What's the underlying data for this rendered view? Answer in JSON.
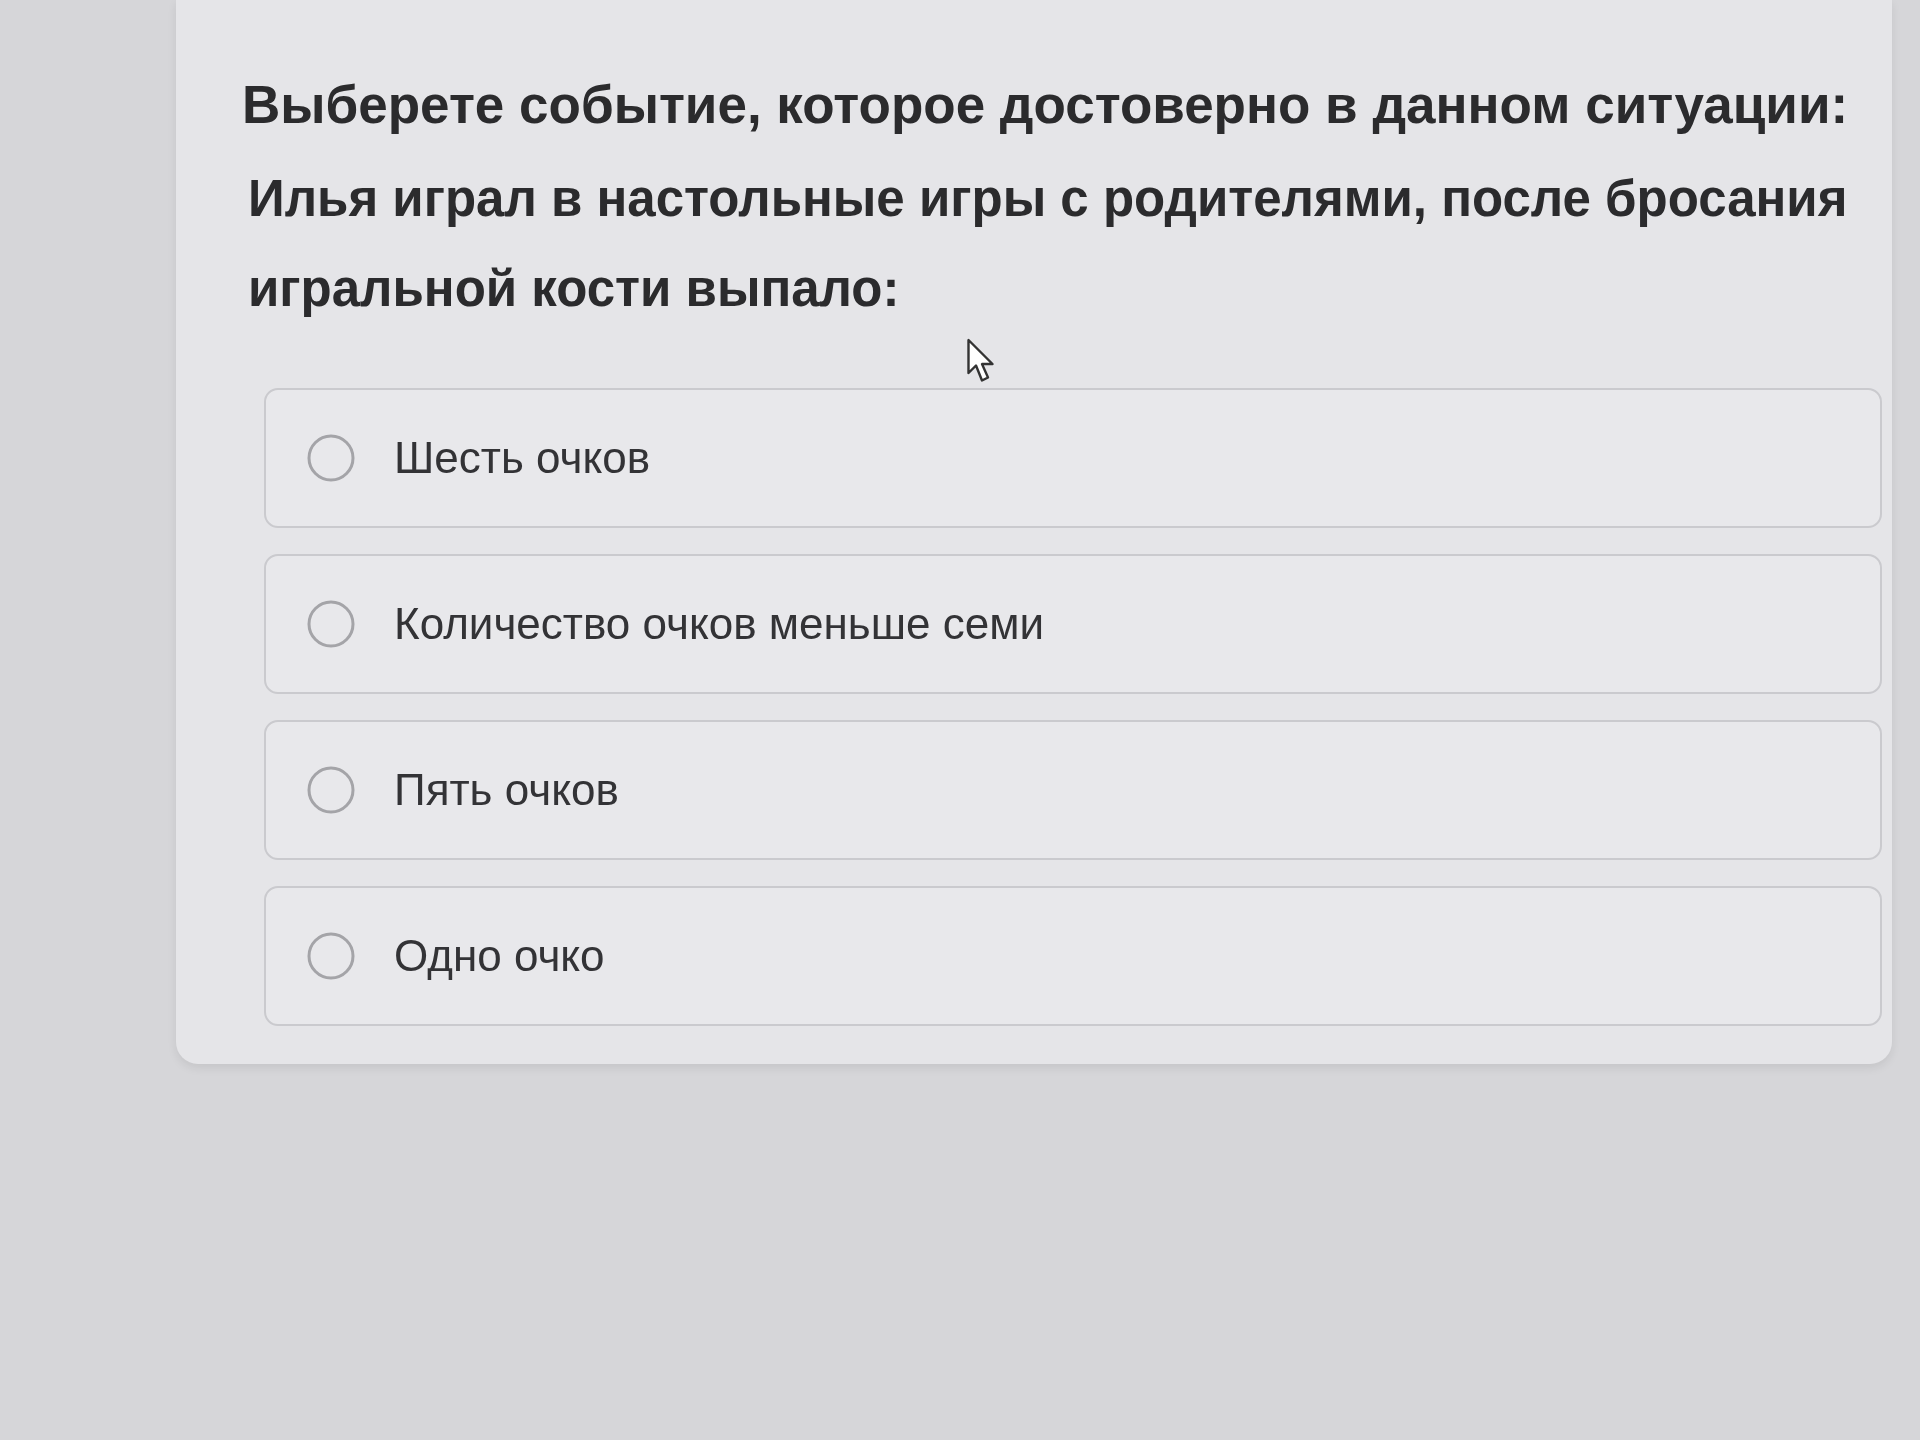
{
  "question": {
    "instruction": "Выберете событие, которое достоверно в данном ситуации:",
    "text": "Илья играл в настольные игры с родителями, после бросания игральной кости выпало:"
  },
  "options": [
    {
      "label": "Шесть очков",
      "selected": false
    },
    {
      "label": "Количество очков меньше семи",
      "selected": false
    },
    {
      "label": "Пять очков",
      "selected": false
    },
    {
      "label": "Одно очко",
      "selected": false
    }
  ]
}
